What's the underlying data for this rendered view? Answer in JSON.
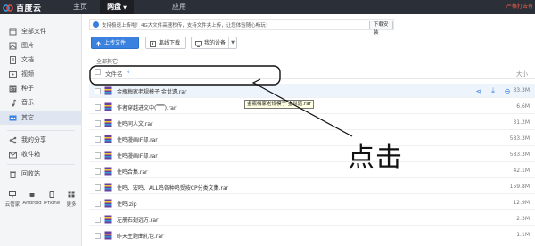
{
  "app": {
    "logo_text": "百度云",
    "nav": [
      {
        "label": "主页"
      },
      {
        "label": "网盘"
      },
      {
        "label": "应用"
      }
    ],
    "top_right": "严格打击有"
  },
  "sidebar": {
    "items": [
      {
        "label": "全部文件",
        "icon": "folder-icon"
      },
      {
        "label": "图片",
        "icon": "image-icon"
      },
      {
        "label": "文档",
        "icon": "document-icon"
      },
      {
        "label": "视频",
        "icon": "video-icon"
      },
      {
        "label": "种子",
        "icon": "bt-icon"
      },
      {
        "label": "音乐",
        "icon": "music-icon"
      },
      {
        "label": "其它",
        "icon": "more-icon"
      },
      {
        "label": "我的分享",
        "icon": "share-icon"
      },
      {
        "label": "收件箱",
        "icon": "inbox-icon"
      },
      {
        "label": "回收站",
        "icon": "trash-icon"
      }
    ],
    "devices": [
      {
        "label": "云管家"
      },
      {
        "label": "Android"
      },
      {
        "label": "iPhone"
      },
      {
        "label": "更多"
      }
    ]
  },
  "notice": {
    "text": "支持极速上传啦！4G大文件高速秒传，支持文件夹上传，让您体验随心畅玩！",
    "button": "下载安装"
  },
  "toolbar": {
    "upload": "上传文件",
    "offline": "离线下载",
    "device": "我的设备"
  },
  "breadcrumb": "全部其它",
  "list": {
    "col_name": "文件名",
    "col_size": "大小",
    "rows": [
      {
        "name": "金瓶梅家老规模子 金世遗.rar",
        "size": "33.3M"
      },
      {
        "name": "作者穿越进文中(▔▔).rar",
        "size": "6.6M"
      },
      {
        "name": "住鸣同人文.rar",
        "size": "31.2M"
      },
      {
        "name": "住鸣漫画IF部.rar",
        "size": "583.3M"
      },
      {
        "name": "住鸣漫画IF部.rar",
        "size": "583.3M"
      },
      {
        "name": "住鸣合集.rar",
        "size": "42.1M"
      },
      {
        "name": "住鸣、宏鸣、ALL鸣各种鸣受按CP分类文集.rar",
        "size": "159.8M"
      },
      {
        "name": "住鸣.zip",
        "size": "12.9M"
      },
      {
        "name": "左册右翅远方.rar",
        "size": "2.3M"
      },
      {
        "name": "昨天主题曲礼包.rar",
        "size": "1.1M"
      }
    ]
  },
  "tooltip": "金瓶梅家老规模子 金世遗.rar",
  "annotation": "点击",
  "colors": {
    "topbar": "#2b2f38",
    "accent": "#3a81e0",
    "sidebar_bg": "#f4f5f7",
    "active_bg": "#dfe6f2"
  }
}
